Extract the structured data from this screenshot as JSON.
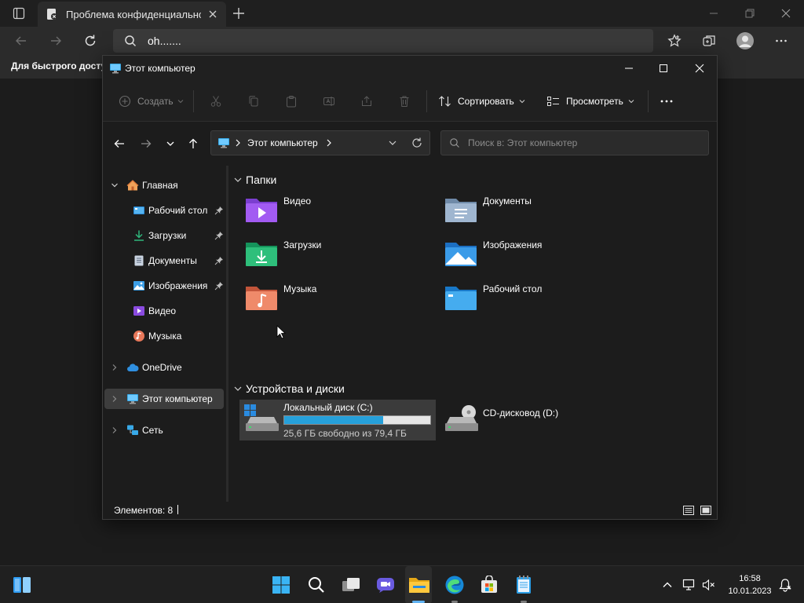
{
  "browser": {
    "tab_title": "Проблема конфиденциальности",
    "url": "oh.......",
    "favorites_bar_text": "Для быстрого доступа"
  },
  "explorer": {
    "window_title": "Этот компьютер",
    "toolbar": {
      "create": "Создать",
      "sort": "Сортировать",
      "view": "Просмотреть"
    },
    "address": {
      "crumb": "Этот компьютер",
      "search_placeholder": "Поиск в: Этот компьютер"
    },
    "sidebar": {
      "home": "Главная",
      "desktop": "Рабочий стол",
      "downloads": "Загрузки",
      "documents": "Документы",
      "pictures": "Изображения",
      "videos": "Видео",
      "music": "Музыка",
      "onedrive": "OneDrive",
      "this_pc": "Этот компьютер",
      "network": "Сеть"
    },
    "folders_header": "Папки",
    "folders": {
      "videos": "Видео",
      "documents": "Документы",
      "downloads": "Загрузки",
      "pictures": "Изображения",
      "music": "Музыка",
      "desktop": "Рабочий стол"
    },
    "devices_header": "Устройства и диски",
    "drive_c": {
      "name": "Локальный диск (C:)",
      "free_text": "25,6 ГБ свободно из 79,4 ГБ",
      "used_fraction": 0.68
    },
    "drive_d": {
      "name": "CD-дисковод (D:)"
    },
    "status": "Элементов: 8"
  },
  "taskbar": {
    "time": "16:58",
    "date": "10.01.2023"
  },
  "colors": {
    "accent": "#26a0da",
    "window_bg": "#1c1c1c",
    "toolbar_bg": "#202020"
  }
}
